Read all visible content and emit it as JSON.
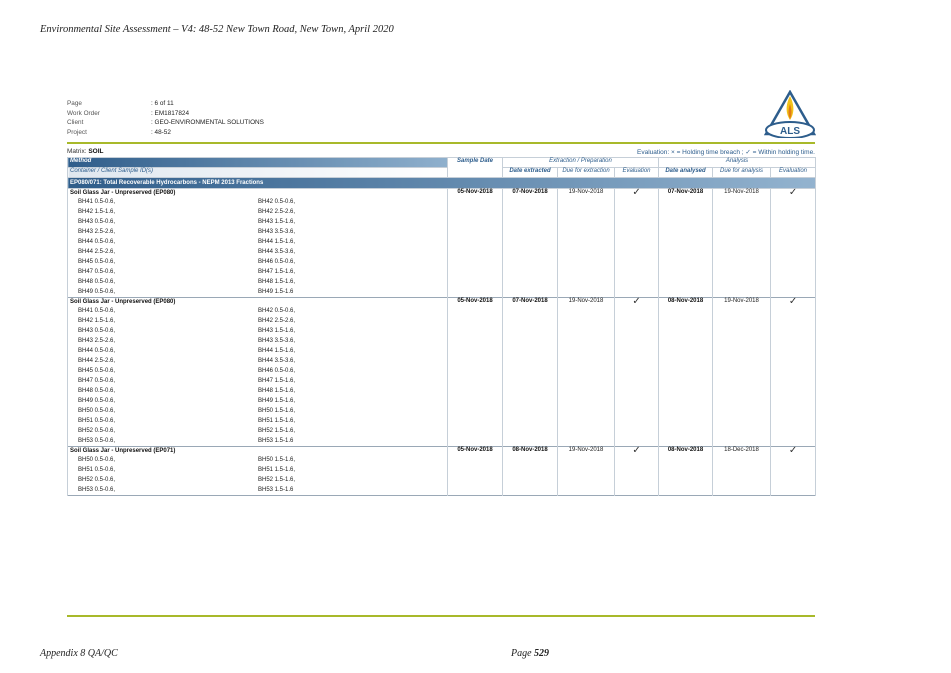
{
  "doc_header": "Environmental Site Assessment – V4: 48-52 New Town Road, New Town, April 2020",
  "meta": [
    {
      "label": "Page",
      "value": ": 6 of 11"
    },
    {
      "label": "Work Order",
      "value": ": EM1817824"
    },
    {
      "label": "Client",
      "value": ": GEO-ENVIRONMENTAL SOLUTIONS"
    },
    {
      "label": "Project",
      "value": ": 48-52"
    }
  ],
  "logo_text": "ALS",
  "matrix": {
    "label": "Matrix:",
    "value": "SOIL"
  },
  "evaluation_legend": "Evaluation: × = Holding time breach ; ✓ = Within holding time.",
  "table_header": {
    "method": "Method",
    "sample_date": "Sample Date",
    "extraction": "Extraction / Preparation",
    "analysis": "Analysis",
    "container": "Container / Client Sample ID(s)",
    "date_extracted": "Date extracted",
    "due_extraction": "Due for extraction",
    "evaluation": "Evaluation",
    "date_analysed": "Date analysed",
    "due_analysis": "Due for analysis",
    "evaluation2": "Evaluation"
  },
  "section_title": "EP080/071: Total Recoverable Hydrocarbons - NEPM 2013 Fractions",
  "groups": [
    {
      "title": "Soil Glass Jar - Unpreserved (EP080)",
      "left": [
        "BH41 0.5-0.6,",
        "BH42 1.5-1.6,",
        "BH43 0.5-0.6,",
        "BH43 2.5-2.6,",
        "BH44 0.5-0.6,",
        "BH44 2.5-2.6,",
        "BH45 0.5-0.6,",
        "BH47 0.5-0.6,",
        "BH48 0.5-0.6,",
        "BH49 0.5-0.6,"
      ],
      "right": [
        "BH42 0.5-0.6,",
        "BH42 2.5-2.6,",
        "BH43 1.5-1.6,",
        "BH43 3.5-3.6,",
        "BH44 1.5-1.6,",
        "BH44 3.5-3.6,",
        "BH46 0.5-0.6,",
        "BH47 1.5-1.6,",
        "BH48 1.5-1.6,",
        "BH49 1.5-1.6"
      ],
      "sample_date": "05-Nov-2018",
      "date_extracted": "07-Nov-2018",
      "due_extraction": "19-Nov-2018",
      "eval1": "✓",
      "date_analysed": "07-Nov-2018",
      "due_analysis": "19-Nov-2018",
      "eval2": "✓"
    },
    {
      "title": "Soil Glass Jar - Unpreserved (EP080)",
      "left": [
        "BH41 0.5-0.6,",
        "BH42 1.5-1.6,",
        "BH43 0.5-0.6,",
        "BH43 2.5-2.6,",
        "BH44 0.5-0.6,",
        "BH44 2.5-2.6,",
        "BH45 0.5-0.6,",
        "BH47 0.5-0.6,",
        "BH48 0.5-0.6,",
        "BH49 0.5-0.6,",
        "BH50 0.5-0.6,",
        "BH51 0.5-0.6,",
        "BH52 0.5-0.6,",
        "BH53 0.5-0.6,"
      ],
      "right": [
        "BH42 0.5-0.6,",
        "BH42 2.5-2.6,",
        "BH43 1.5-1.6,",
        "BH43 3.5-3.6,",
        "BH44 1.5-1.6,",
        "BH44 3.5-3.6,",
        "BH46 0.5-0.6,",
        "BH47 1.5-1.6,",
        "BH48 1.5-1.6,",
        "BH49 1.5-1.6,",
        "BH50 1.5-1.6,",
        "BH51 1.5-1.6,",
        "BH52 1.5-1.6,",
        "BH53 1.5-1.6"
      ],
      "sample_date": "05-Nov-2018",
      "date_extracted": "07-Nov-2018",
      "due_extraction": "19-Nov-2018",
      "eval1": "✓",
      "date_analysed": "08-Nov-2018",
      "due_analysis": "19-Nov-2018",
      "eval2": "✓"
    },
    {
      "title": "Soil Glass Jar - Unpreserved (EP071)",
      "left": [
        "BH50 0.5-0.6,",
        "BH51 0.5-0.6,",
        "BH52 0.5-0.6,",
        "BH53 0.5-0.6,"
      ],
      "right": [
        "BH50 1.5-1.6,",
        "BH51 1.5-1.6,",
        "BH52 1.5-1.6,",
        "BH53 1.5-1.6"
      ],
      "sample_date": "05-Nov-2018",
      "date_extracted": "08-Nov-2018",
      "due_extraction": "19-Nov-2018",
      "eval1": "✓",
      "date_analysed": "08-Nov-2018",
      "due_analysis": "18-Dec-2018",
      "eval2": "✓"
    }
  ],
  "footer_left": "Appendix 8 QA/QC",
  "footer_page_label": "Page",
  "footer_page_num": "529",
  "colors": {
    "accent_green": "#a8b92a",
    "header_blue": "#2f5d8a",
    "text_blue": "#2d5d8c"
  }
}
